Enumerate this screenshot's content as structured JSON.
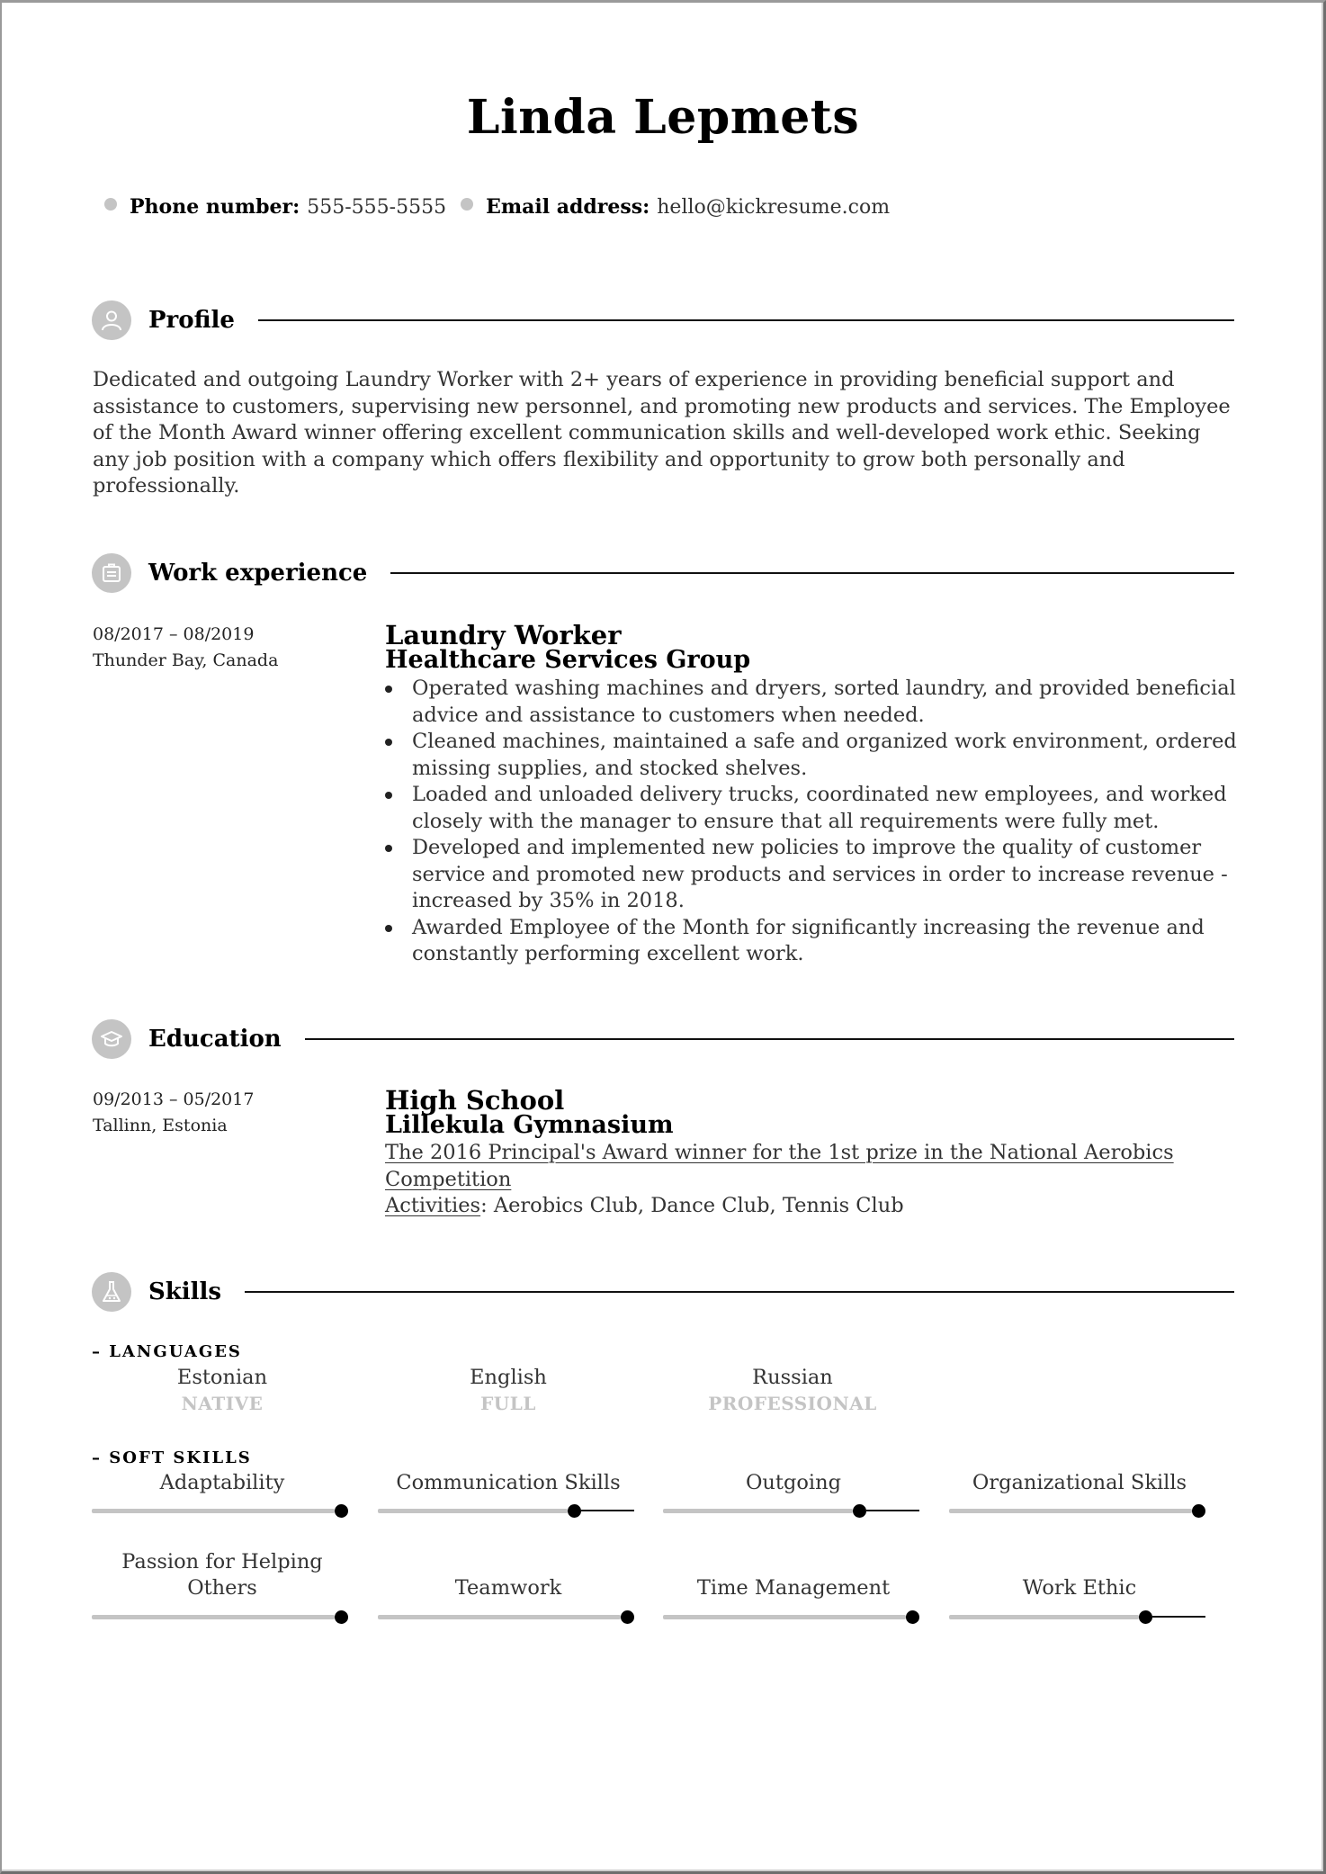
{
  "name": "Linda Lepmets",
  "contact": [
    {
      "label": "Phone number:",
      "value": "555-555-5555"
    },
    {
      "label": "Email address:",
      "value": "hello@kickresume.com"
    }
  ],
  "sections": {
    "profile": {
      "title": "Profile",
      "icon": "user-icon",
      "text": "Dedicated and outgoing Laundry Worker with 2+ years of experience in providing beneficial support and assistance to customers, supervising new personnel, and promoting new products and services. The Employee of the Month Award winner offering excellent communication skills and well-developed work ethic. Seeking any job position with a company which offers flexibility and opportunity to grow both personally and professionally."
    },
    "work": {
      "title": "Work experience",
      "icon": "briefcase-icon",
      "jobs": [
        {
          "dates": "08/2017 – 08/2019",
          "location": "Thunder Bay, Canada",
          "title": "Laundry Worker",
          "company": "Healthcare Services Group",
          "bullets": [
            "Operated washing machines and dryers, sorted laundry, and provided beneficial advice and assistance to customers when needed.",
            "Cleaned machines, maintained a safe and organized work environment, ordered missing supplies, and stocked shelves.",
            "Loaded and unloaded delivery trucks, coordinated new employees, and worked closely with the manager to ensure that all requirements were fully met.",
            "Developed and implemented new policies to improve the quality of customer service and promoted new products and services in order to increase revenue - increased by 35% in 2018.",
            "Awarded Employee of the Month for significantly increasing the revenue and constantly performing excellent work."
          ]
        }
      ]
    },
    "education": {
      "title": "Education",
      "icon": "graduation-cap-icon",
      "entries": [
        {
          "dates": "09/2013 – 05/2017",
          "location": "Tallinn, Estonia",
          "degree": "High School",
          "school": "Lillekula Gymnasium",
          "award": "The 2016 Principal's Award winner for the 1st prize in the National Aerobics Competition",
          "activities_label": "Activities",
          "activities": ": Aerobics Club, Dance Club, Tennis Club"
        }
      ]
    },
    "skills": {
      "title": "Skills",
      "icon": "flask-icon",
      "languages_label": "– LANGUAGES",
      "languages": [
        {
          "name": "Estonian",
          "level": "NATIVE"
        },
        {
          "name": "English",
          "level": "FULL"
        },
        {
          "name": "Russian",
          "level": "PROFESSIONAL"
        }
      ],
      "soft_label": "– SOFT SKILLS",
      "soft": [
        {
          "name": "Adaptability",
          "level": 1.0
        },
        {
          "name": "Communication Skills",
          "level": 0.78
        },
        {
          "name": "Outgoing",
          "level": 0.78
        },
        {
          "name": "Organizational Skills",
          "level": 1.0
        },
        {
          "name": "Passion for Helping Others",
          "level": 1.0
        },
        {
          "name": "Teamwork",
          "level": 1.0
        },
        {
          "name": "Time Management",
          "level": 1.0
        },
        {
          "name": "Work Ethic",
          "level": 0.78
        }
      ]
    }
  }
}
